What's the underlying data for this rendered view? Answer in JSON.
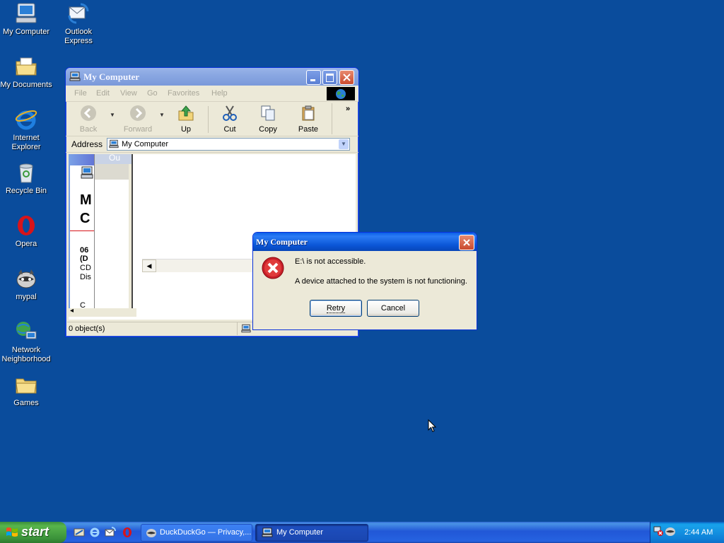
{
  "desktop": {
    "icons": [
      {
        "label": "My Computer"
      },
      {
        "label": "Outlook Express"
      },
      {
        "label": "My Documents"
      },
      {
        "label": "Internet Explorer"
      },
      {
        "label": "Recycle Bin"
      },
      {
        "label": "Opera"
      },
      {
        "label": "mypal"
      },
      {
        "label": "Network Neighborhood"
      },
      {
        "label": "Games"
      }
    ]
  },
  "explorer": {
    "title": "My Computer",
    "menu": [
      "File",
      "Edit",
      "View",
      "Go",
      "Favorites",
      "Help"
    ],
    "toolbar": {
      "back": "Back",
      "forward": "Forward",
      "up": "Up",
      "cut": "Cut",
      "copy": "Copy",
      "paste": "Paste",
      "more": "»"
    },
    "address_label": "Address",
    "address_value": "My Computer",
    "status": "0 object(s)",
    "left_panel_fragments": [
      "M",
      "C",
      "06",
      "(D",
      "CD",
      "Dis",
      "Ou",
      "C"
    ]
  },
  "dialog": {
    "title": "My Computer",
    "line1": "E:\\ is not accessible.",
    "line2": "A device attached to the system is not functioning.",
    "retry": "Retry",
    "cancel": "Cancel"
  },
  "taskbar": {
    "start": "start",
    "tasks": [
      {
        "label": "DuckDuckGo — Privacy,..."
      },
      {
        "label": "My Computer"
      }
    ],
    "clock": "2:44 AM"
  },
  "colors": {
    "desktop": "#0a4c9c",
    "error_red": "#c8202a",
    "active_title": "#0a55d6",
    "inactive_title": "#8aa7e2"
  }
}
